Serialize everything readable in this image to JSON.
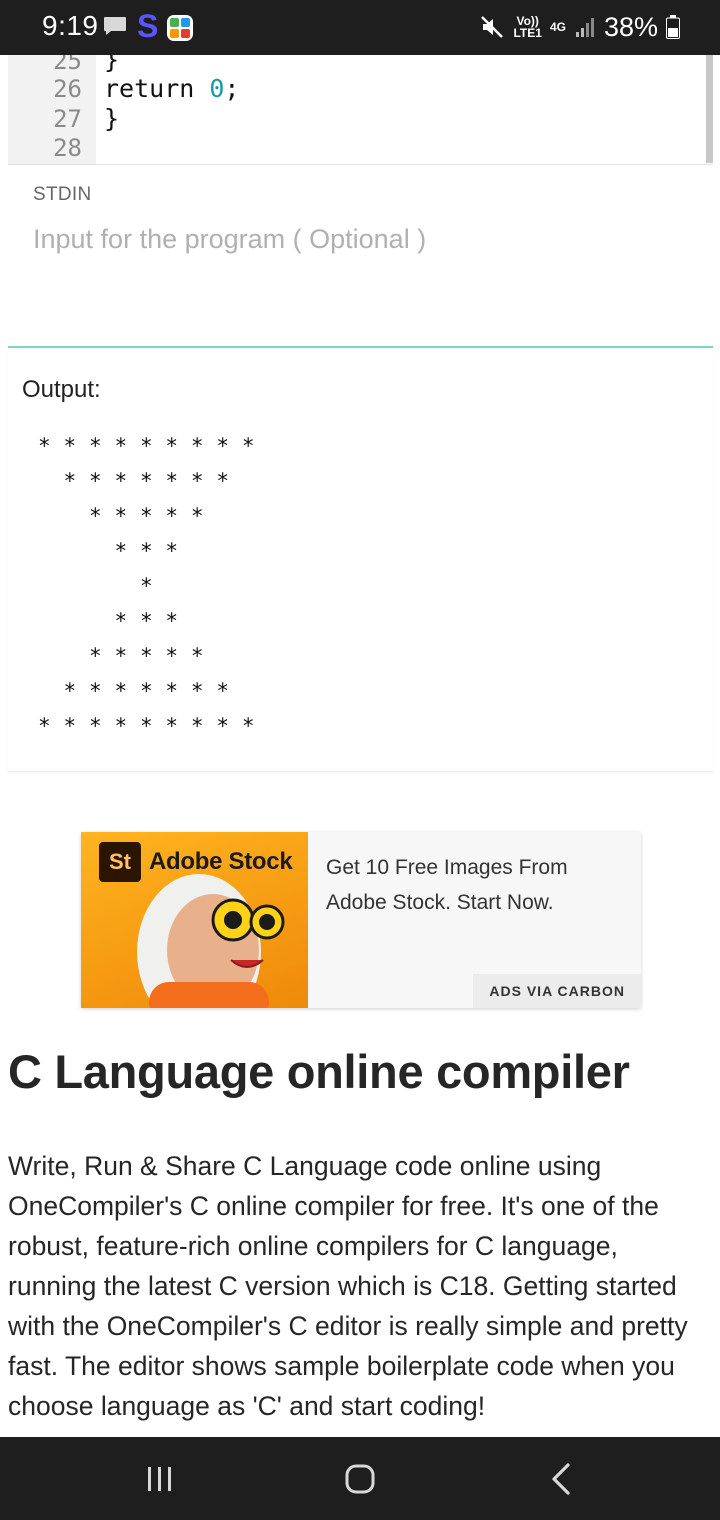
{
  "status_bar": {
    "time": "9:19",
    "app_icon_letter": "S",
    "volte": "Vo))",
    "lte": "LTE1",
    "network": "4G",
    "battery": "38%",
    "icons": [
      "message-icon",
      "s-app-icon",
      "grid-app-icon",
      "mute-icon",
      "signal-icon",
      "battery-icon"
    ]
  },
  "editor": {
    "lines": [
      {
        "num": "25",
        "code": "}"
      },
      {
        "num": "26",
        "code_keyword": "return ",
        "code_number": "0",
        "code_tail": ";"
      },
      {
        "num": "27",
        "code": "}"
      },
      {
        "num": "28",
        "code": ""
      }
    ]
  },
  "stdin": {
    "label": "STDIN",
    "placeholder": "Input for the program ( Optional )",
    "value": ""
  },
  "output": {
    "label": "Output:",
    "lines": [
      "* * * * * * * * *",
      "  * * * * * * *",
      "    * * * * *",
      "      * * *",
      "        *",
      "      * * *",
      "    * * * * *",
      "  * * * * * * *",
      "* * * * * * * * *"
    ]
  },
  "ad": {
    "logo_mark": "St",
    "brand": "Adobe Stock",
    "text": "Get 10 Free Images From Adobe Stock. Start Now.",
    "carbon_label": "ADS VIA CARBON"
  },
  "article": {
    "heading": "C Language online compiler",
    "paragraph": "Write, Run & Share C Language code online using OneCompiler's C online compiler for free. It's one of the robust, feature-rich online compilers for C language, running the latest C version which is C18. Getting started with the OneCompiler's C editor is really simple and pretty fast. The editor shows sample boilerplate code when you choose language as 'C' and start coding!"
  },
  "nav_bar": {
    "icons": [
      "recent-apps-icon",
      "home-icon",
      "back-icon"
    ]
  },
  "colors": {
    "status_bar_bg": "#1e1e1e",
    "accent_teal": "#7fd3bf",
    "number_literal": "#1a9aa0",
    "ad_orange": "#f59a12"
  }
}
